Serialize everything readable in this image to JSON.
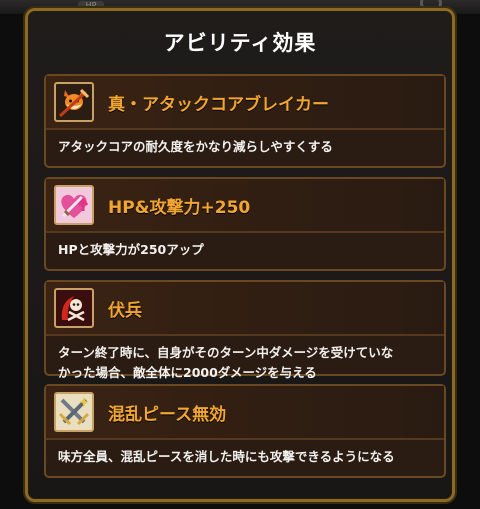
{
  "background": {
    "hp_label": "HP"
  },
  "dialog": {
    "title": "アビリティ効果",
    "abilities": [
      {
        "name": "真・アタックコアブレイカー",
        "description_lines": [
          "アタックコアの耐久度をかなり減らしやすくする"
        ],
        "icon": "fox-breaker-icon"
      },
      {
        "name": "HP&攻撃力+250",
        "description_lines": [
          "HPと攻撃力が250アップ"
        ],
        "icon": "heart-sword-icon"
      },
      {
        "name": "伏兵",
        "description_lines": [
          "ターン終了時に、自身がそのターン中ダメージを受けていな",
          "かった場合、敵全体に2000ダメージを与える"
        ],
        "icon": "ambush-icon"
      },
      {
        "name": "混乱ピース無効",
        "description_lines": [
          "味方全員、混乱ピースを消した時にも攻撃できるようになる"
        ],
        "icon": "crossed-swords-icon"
      }
    ]
  },
  "colors": {
    "ability_name": "#f2a531",
    "frame_gold": "#8b6a24",
    "text": "#f3f1ee"
  }
}
